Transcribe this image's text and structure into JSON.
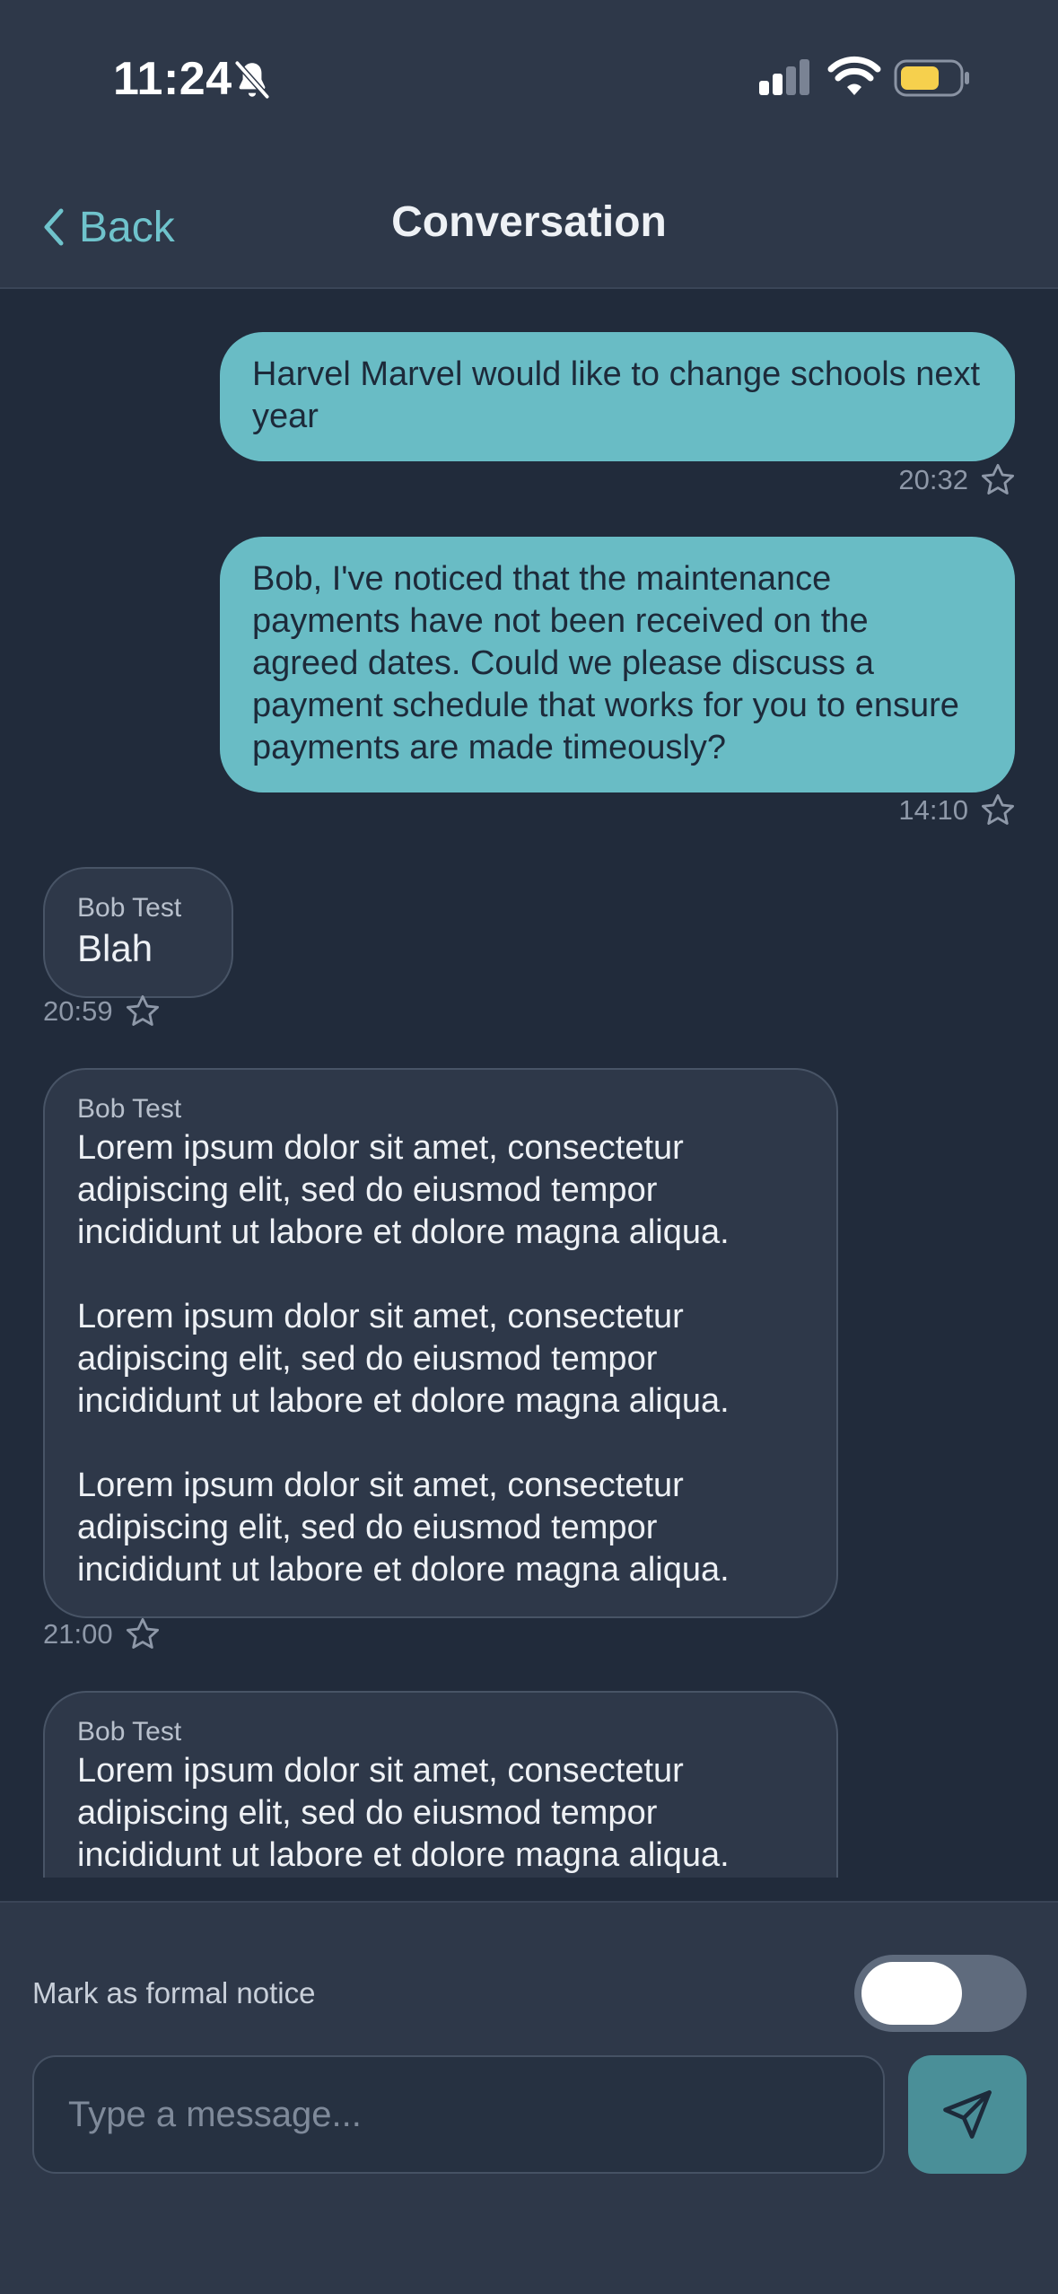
{
  "status_bar": {
    "time": "11:24",
    "icons": [
      "bell-slash-icon",
      "cellular-signal-icon",
      "wifi-icon",
      "battery-icon"
    ],
    "battery_color": "#f6d04d"
  },
  "nav": {
    "back_label": "Back",
    "title": "Conversation"
  },
  "messages": [
    {
      "direction": "outgoing",
      "text": "Harvel Marvel would like to change schools next year",
      "time": "20:32"
    },
    {
      "direction": "outgoing",
      "text": "Bob, I've noticed that the maintenance payments have not been received on the agreed dates. Could we please discuss a payment schedule that works for you to ensure payments are made timeously?",
      "time": "14:10"
    },
    {
      "direction": "incoming",
      "sender": "Bob Test",
      "text": "Blah",
      "time": "20:59"
    },
    {
      "direction": "incoming",
      "sender": "Bob Test",
      "paragraphs": [
        "Lorem ipsum dolor sit amet, consectetur adipiscing elit, sed do eiusmod tempor incididunt ut labore et dolore magna aliqua.",
        "Lorem ipsum dolor sit amet, consectetur adipiscing elit, sed do eiusmod tempor incididunt ut labore et dolore magna aliqua.",
        "Lorem ipsum dolor sit amet, consectetur adipiscing elit, sed do eiusmod tempor incididunt ut labore et dolore magna aliqua."
      ],
      "time": "21:00"
    },
    {
      "direction": "incoming",
      "sender": "Bob Test",
      "text": "Lorem ipsum dolor sit amet, consectetur adipiscing elit, sed do eiusmod tempor incididunt ut labore et dolore magna aliqua."
    }
  ],
  "composer": {
    "formal_label": "Mark as formal notice",
    "formal_toggle_on": false,
    "input_placeholder": "Type a message...",
    "input_value": ""
  },
  "colors": {
    "accent": "#69bcc5",
    "background": "#212b3b",
    "surface": "#2e3849",
    "send_button": "#4a8f98"
  }
}
